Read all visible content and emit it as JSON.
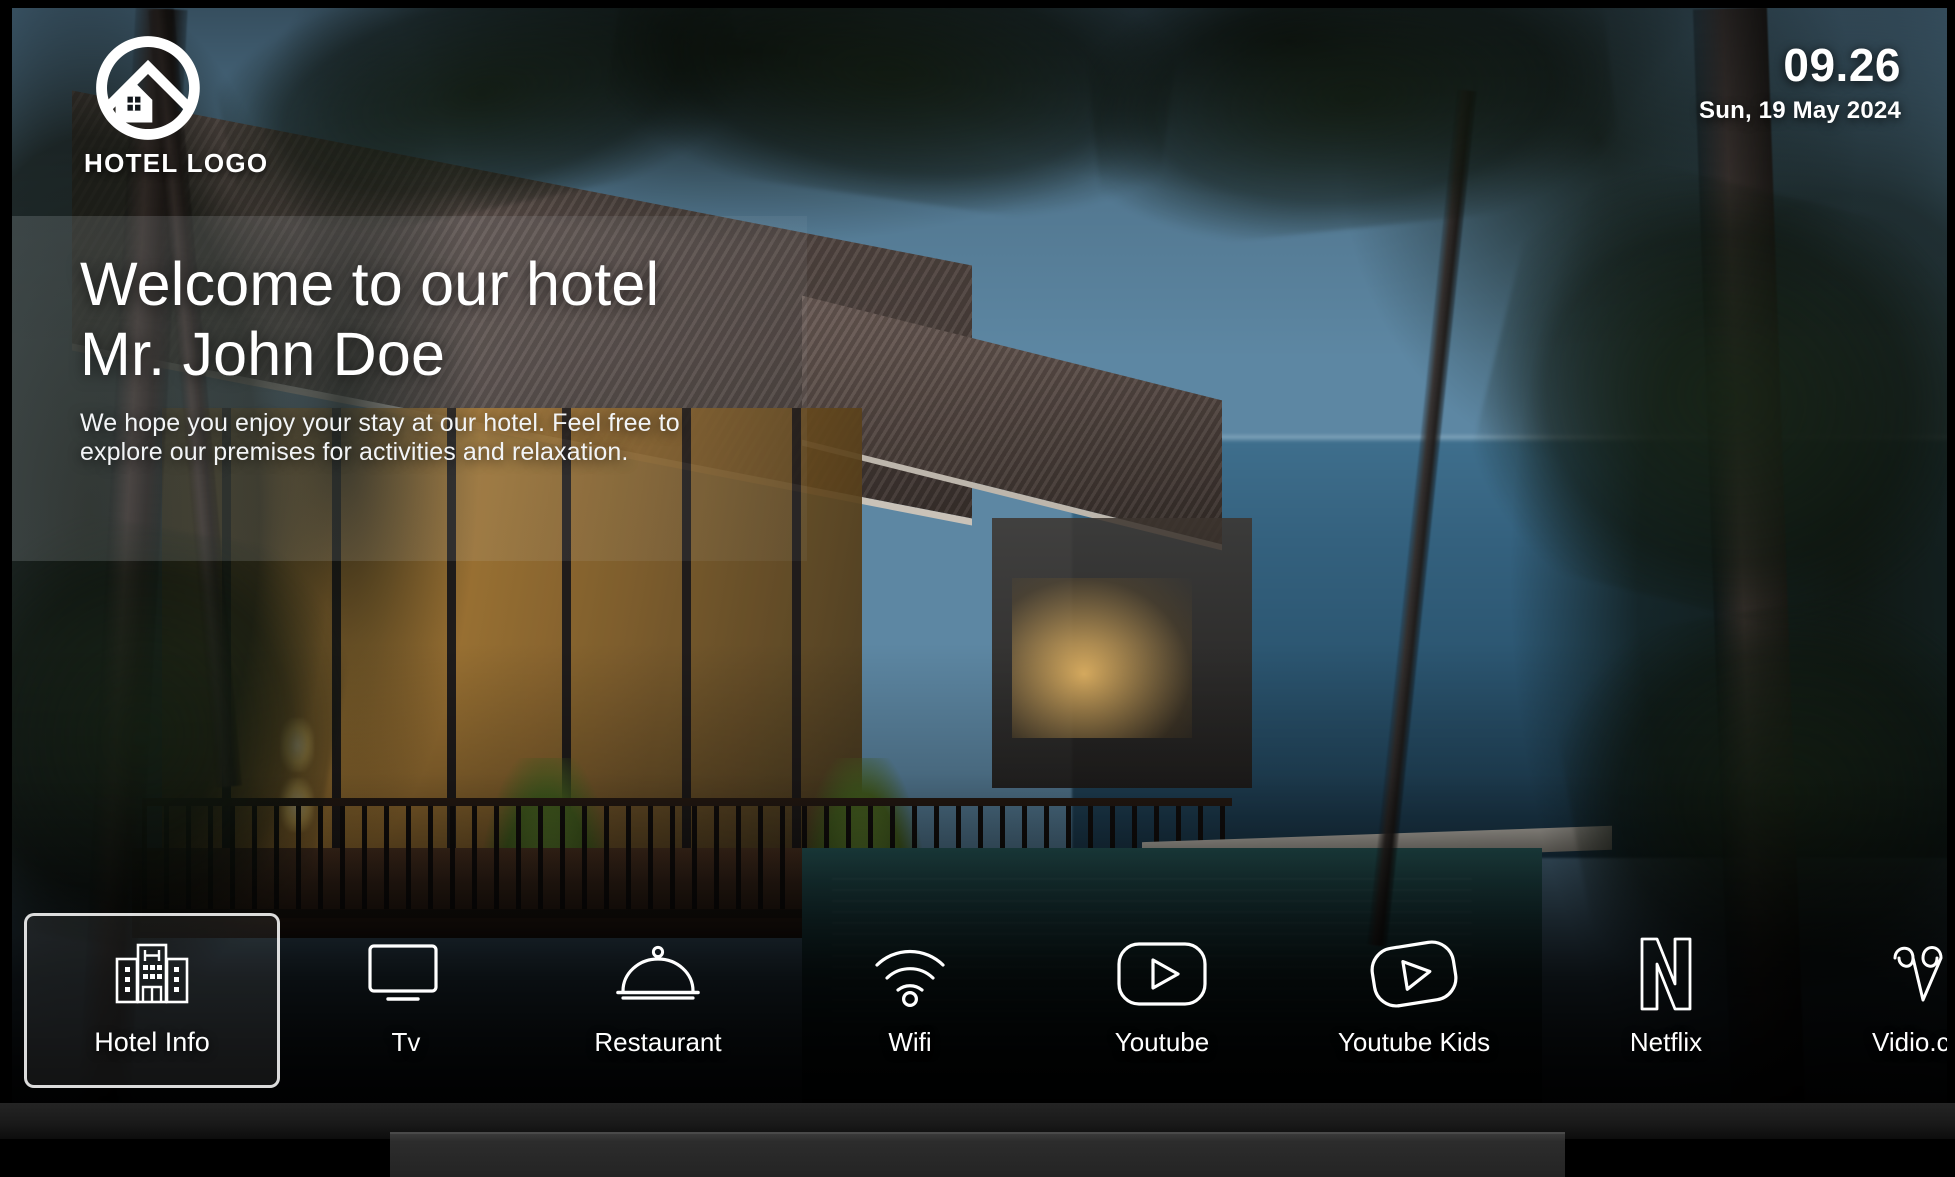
{
  "header": {
    "logo_text": "HOTEL LOGO",
    "logo_icon": "mountain-house-circle-logo",
    "time": "09.26",
    "date": "Sun, 19 May 2024"
  },
  "welcome": {
    "line1": "Welcome to our hotel",
    "line2": "Mr. John Doe",
    "description": "We hope you enjoy your stay at our hotel. Feel free to explore our premises for activities and relaxation."
  },
  "nav": {
    "selected_index": 0,
    "items": [
      {
        "label": "Hotel Info",
        "icon": "buildings-icon",
        "selected": true
      },
      {
        "label": "Tv",
        "icon": "monitor-icon",
        "selected": false
      },
      {
        "label": "Restaurant",
        "icon": "cloche-icon",
        "selected": false
      },
      {
        "label": "Wifi",
        "icon": "wifi-icon",
        "selected": false
      },
      {
        "label": "Youtube",
        "icon": "youtube-icon",
        "selected": false
      },
      {
        "label": "Youtube Kids",
        "icon": "youtube-kids-icon",
        "selected": false
      },
      {
        "label": "Netflix",
        "icon": "netflix-n-icon",
        "selected": false
      },
      {
        "label": "Vidio.co",
        "icon": "vidio-v-icon",
        "selected": false
      }
    ]
  },
  "colors": {
    "text": "#ffffff",
    "selection_border": "#ffffff",
    "scrim": "#000000"
  }
}
